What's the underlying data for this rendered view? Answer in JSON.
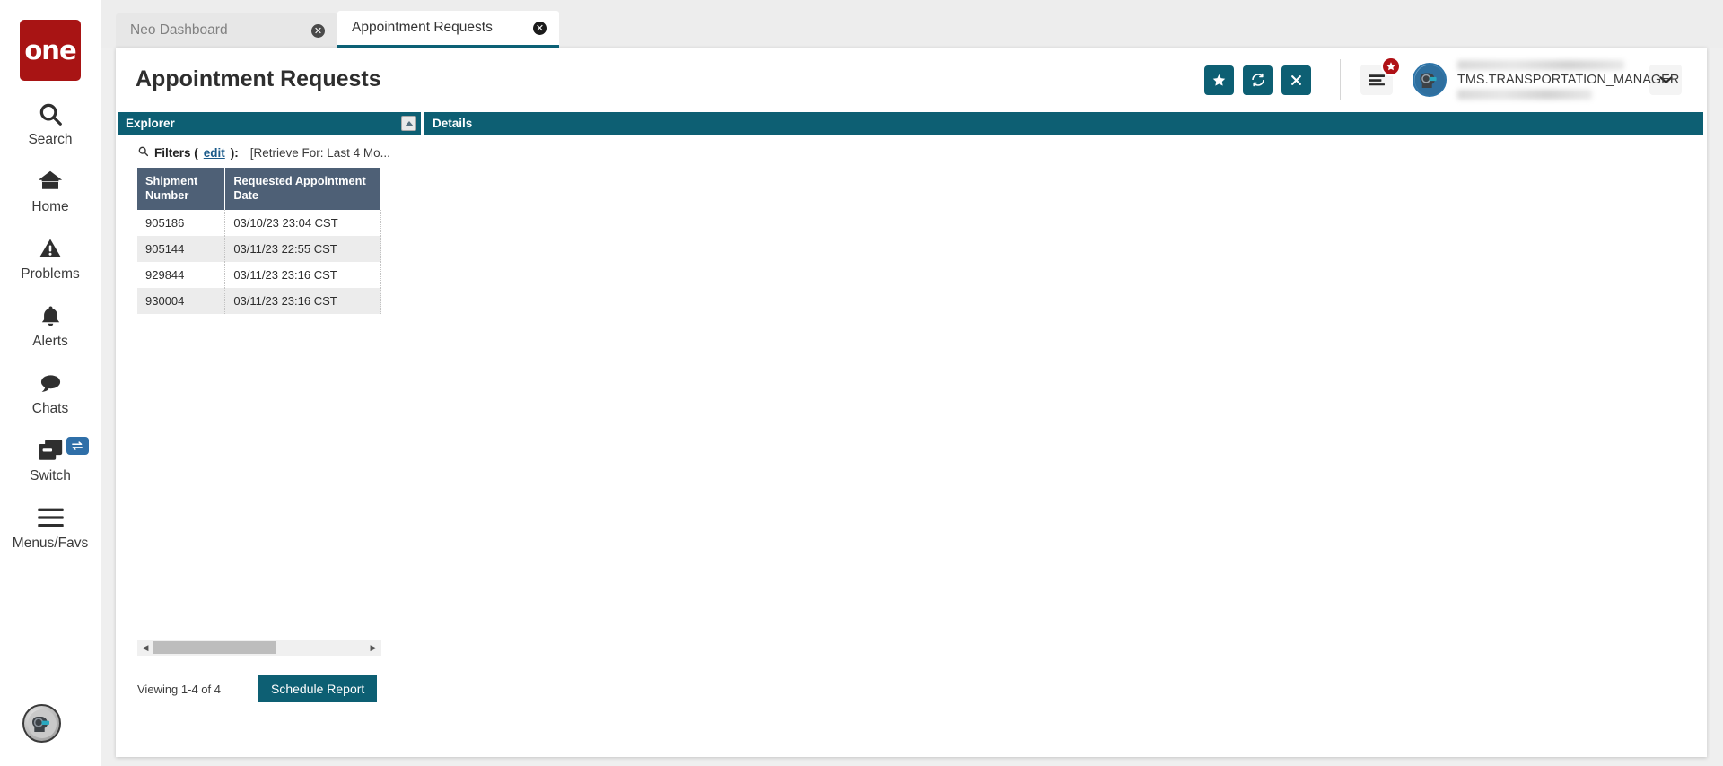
{
  "sidebar": {
    "logo_text": "one",
    "items": [
      {
        "label": "Search",
        "icon": "search-icon"
      },
      {
        "label": "Home",
        "icon": "home-icon"
      },
      {
        "label": "Problems",
        "icon": "warning-triangle-icon"
      },
      {
        "label": "Alerts",
        "icon": "bell-icon"
      },
      {
        "label": "Chats",
        "icon": "chat-bubble-icon"
      },
      {
        "label": "Switch",
        "icon": "switch-windows-icon"
      },
      {
        "label": "Menus/Favs",
        "icon": "hamburger-icon"
      }
    ],
    "avatar_icon": "user-avatar-robot-icon"
  },
  "tabs": [
    {
      "label": "Neo Dashboard",
      "active": false,
      "close_icon": "close-circle-icon"
    },
    {
      "label": "Appointment Requests",
      "active": true,
      "close_icon": "close-circle-icon"
    }
  ],
  "header": {
    "title": "Appointment Requests",
    "actions": [
      {
        "name": "favorite-button",
        "icon": "star-icon",
        "label": "★"
      },
      {
        "name": "refresh-button",
        "icon": "refresh-icon",
        "label": "↻"
      },
      {
        "name": "close-button",
        "icon": "x-icon",
        "label": "✕"
      }
    ],
    "menu_button": {
      "icon": "hamburger-icon",
      "badge_icon": "star-badge-icon"
    },
    "user": {
      "name": "TMS.TRANSPORTATION_MANAGER",
      "avatar_icon": "user-avatar-robot-icon",
      "caret_icon": "chevron-down-icon"
    }
  },
  "explorer": {
    "title": "Explorer",
    "collapse_icon": "caret-up-icon",
    "filters": {
      "search_icon": "magnifier-icon",
      "label": "Filters (",
      "link": "edit",
      "label_end": "):",
      "description": "[Retrieve For: Last 4 Mo..."
    },
    "table": {
      "columns": [
        "Shipment Number",
        "Requested Appointment Date"
      ],
      "rows": [
        {
          "shipment_number": "905186",
          "requested_appointment_date": "03/10/23 23:04 CST"
        },
        {
          "shipment_number": "905144",
          "requested_appointment_date": "03/11/23 22:55 CST"
        },
        {
          "shipment_number": "929844",
          "requested_appointment_date": "03/11/23 23:16 CST"
        },
        {
          "shipment_number": "930004",
          "requested_appointment_date": "03/11/23 23:16 CST"
        }
      ]
    },
    "scroll": {
      "left_arrow": "◀",
      "right_arrow": "▶"
    },
    "footer": {
      "viewing_text": "Viewing 1-4 of 4",
      "schedule_button": "Schedule Report"
    }
  },
  "details": {
    "title": "Details"
  },
  "colors": {
    "teal": "#0d5f73",
    "brand_red": "#a81414",
    "table_header": "#4e6076",
    "badge_red": "#b01116",
    "switch_badge_blue": "#2f6fa8",
    "link_blue": "#1a5a8a"
  }
}
